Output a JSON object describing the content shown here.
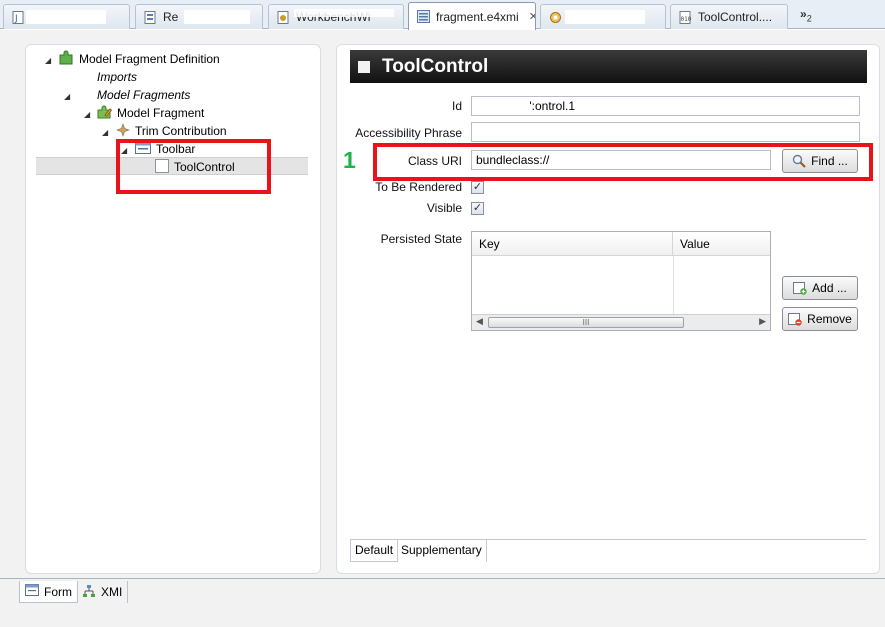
{
  "tabs": [
    {
      "label": "",
      "icon": "java-file-icon",
      "closable": false
    },
    {
      "label": "Re",
      "icon": "class-file-icon",
      "closable": false
    },
    {
      "label": "WorkbenchWi",
      "icon": "xml-file-icon",
      "closable": false
    },
    {
      "label": "fragment.e4xmi",
      "icon": "e4xmi-file-icon",
      "closable": true,
      "active": true
    },
    {
      "label": "",
      "icon": "plugin-icon",
      "closable": false
    },
    {
      "label": "ToolControl....",
      "icon": "binary-class-file-icon",
      "closable": false
    }
  ],
  "tabs_overflow": {
    "label": "»",
    "count": "2"
  },
  "tree": {
    "root": "Model Fragment Definition",
    "imports": "Imports",
    "model_fragments": "Model Fragments",
    "model_fragment": "Model Fragment",
    "trim_contribution": "Trim Contribution",
    "toolbar": "Toolbar",
    "tool_control": "ToolControl"
  },
  "detail": {
    "title": "ToolControl",
    "id_label": "Id",
    "id_value": "                ':ontrol.1",
    "accessibility_label": "Accessibility Phrase",
    "accessibility_value": "",
    "class_uri_label": "Class URI",
    "class_uri_value": "bundleclass://",
    "find_label": "Find ...",
    "to_be_rendered_label": "To Be Rendered",
    "to_be_rendered": true,
    "visible_label": "Visible",
    "visible": true,
    "persisted_state_label": "Persisted State",
    "table_columns": [
      "Key",
      "Value"
    ],
    "add_label": "Add ...",
    "remove_label": "Remove",
    "hscroll_grip": "III"
  },
  "inner_tabs": [
    "Default",
    "Supplementary"
  ],
  "bottom_tabs": [
    "Form",
    "XMI"
  ],
  "annotation": {
    "number": "1"
  },
  "colors": {
    "annotation_red": "#e8141a",
    "annotation_green": "#22b24c",
    "header_dark": "#111111"
  }
}
